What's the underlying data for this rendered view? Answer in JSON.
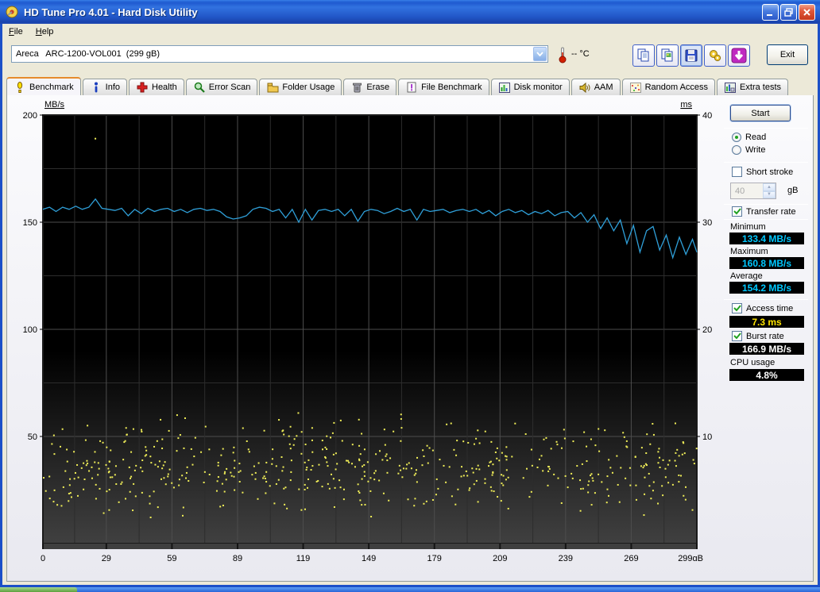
{
  "window": {
    "title": "HD Tune Pro 4.01 - Hard Disk Utility",
    "controls": [
      "minimize",
      "maximize",
      "close"
    ]
  },
  "menu": {
    "items": [
      {
        "label": "File"
      },
      {
        "label": "Help"
      }
    ]
  },
  "toolbar": {
    "drive_selector_value": "Areca   ARC-1200-VOL001  (299 gB)",
    "temperature": "-- °C",
    "buttons": [
      {
        "name": "copy-text"
      },
      {
        "name": "copy-image"
      },
      {
        "name": "save"
      },
      {
        "name": "options"
      },
      {
        "name": "download"
      }
    ],
    "exit_label": "Exit"
  },
  "tabs": [
    {
      "label": "Benchmark",
      "active": true
    },
    {
      "label": "Info"
    },
    {
      "label": "Health"
    },
    {
      "label": "Error Scan"
    },
    {
      "label": "Folder Usage"
    },
    {
      "label": "Erase"
    },
    {
      "label": "File Benchmark"
    },
    {
      "label": "Disk monitor"
    },
    {
      "label": "AAM"
    },
    {
      "label": "Random Access"
    },
    {
      "label": "Extra tests"
    }
  ],
  "panel": {
    "start_label": "Start",
    "read_label": "Read",
    "write_label": "Write",
    "short_stroke_label": "Short stroke",
    "stroke_value": "40",
    "stroke_unit": "gB",
    "transfer_rate_label": "Transfer rate",
    "minimum_label": "Minimum",
    "minimum_value": "133.4 MB/s",
    "maximum_label": "Maximum",
    "maximum_value": "160.8 MB/s",
    "average_label": "Average",
    "average_value": "154.2 MB/s",
    "access_time_label": "Access time",
    "access_time_value": "7.3 ms",
    "burst_rate_label": "Burst rate",
    "burst_rate_value": "166.9 MB/s",
    "cpu_usage_label": "CPU usage",
    "cpu_usage_value": "4.8%"
  },
  "chart_data": {
    "type": "line",
    "title": "HD Tune benchmark: transfer rate line (left axis, MB/s) + access time scatter (right axis, ms)",
    "x_axis": {
      "min": 0,
      "max": 299,
      "ticks": [
        0,
        29,
        59,
        89,
        119,
        149,
        179,
        209,
        239,
        269,
        299
      ],
      "unit": "gB"
    },
    "y_left": {
      "label": "MB/s",
      "min": 0,
      "max": 200,
      "ticks": [
        200,
        150,
        100,
        50
      ]
    },
    "y_right": {
      "label": "ms",
      "min": 0,
      "max": 40,
      "ticks": [
        40,
        30,
        20,
        10
      ]
    },
    "grid": {
      "major_color": "#4d4d4d",
      "minor_color": "#2d2d2d",
      "bg_top": "#000000",
      "bg_bottom": "#404040"
    },
    "series": [
      {
        "name": "transfer-rate",
        "axis": "left",
        "color": "#2f9fd8",
        "points": [
          [
            0,
            156
          ],
          [
            3,
            157
          ],
          [
            6,
            155
          ],
          [
            9,
            157
          ],
          [
            12,
            156
          ],
          [
            15,
            157.5
          ],
          [
            18,
            156
          ],
          [
            21,
            157
          ],
          [
            24,
            160.8
          ],
          [
            27,
            156.5
          ],
          [
            30,
            156
          ],
          [
            33,
            155.5
          ],
          [
            36,
            156.5
          ],
          [
            39,
            153
          ],
          [
            42,
            156
          ],
          [
            45,
            154
          ],
          [
            48,
            156.5
          ],
          [
            51,
            155
          ],
          [
            54,
            156
          ],
          [
            57,
            156.5
          ],
          [
            60,
            155
          ],
          [
            63,
            156
          ],
          [
            66,
            154.5
          ],
          [
            69,
            156
          ],
          [
            72,
            156.5
          ],
          [
            75,
            155.5
          ],
          [
            78,
            156
          ],
          [
            81,
            155
          ],
          [
            84,
            152.5
          ],
          [
            87,
            151.5
          ],
          [
            90,
            152
          ],
          [
            93,
            153
          ],
          [
            96,
            156
          ],
          [
            99,
            157
          ],
          [
            102,
            156.5
          ],
          [
            105,
            155
          ],
          [
            108,
            156
          ],
          [
            111,
            152
          ],
          [
            114,
            156
          ],
          [
            117,
            150
          ],
          [
            120,
            156
          ],
          [
            123,
            151
          ],
          [
            126,
            155.5
          ],
          [
            129,
            156
          ],
          [
            132,
            155
          ],
          [
            135,
            156
          ],
          [
            138,
            153
          ],
          [
            141,
            156
          ],
          [
            144,
            150.5
          ],
          [
            147,
            155
          ],
          [
            150,
            156
          ],
          [
            153,
            155.5
          ],
          [
            156,
            154
          ],
          [
            159,
            155
          ],
          [
            162,
            156.5
          ],
          [
            165,
            155
          ],
          [
            168,
            156
          ],
          [
            171,
            151
          ],
          [
            174,
            156
          ],
          [
            177,
            155
          ],
          [
            180,
            155.5
          ],
          [
            183,
            156
          ],
          [
            186,
            154.5
          ],
          [
            189,
            155.5
          ],
          [
            192,
            156
          ],
          [
            195,
            155
          ],
          [
            198,
            156
          ],
          [
            201,
            154
          ],
          [
            204,
            155.5
          ],
          [
            207,
            153
          ],
          [
            210,
            155
          ],
          [
            213,
            156
          ],
          [
            216,
            154.5
          ],
          [
            219,
            155.5
          ],
          [
            222,
            153.5
          ],
          [
            225,
            155
          ],
          [
            228,
            154
          ],
          [
            231,
            155.5
          ],
          [
            234,
            153
          ],
          [
            237,
            154.5
          ],
          [
            240,
            155
          ],
          [
            243,
            152
          ],
          [
            246,
            154.5
          ],
          [
            249,
            150
          ],
          [
            252,
            153.5
          ],
          [
            255,
            147
          ],
          [
            258,
            152
          ],
          [
            261,
            146
          ],
          [
            264,
            151
          ],
          [
            267,
            140
          ],
          [
            270,
            148.5
          ],
          [
            273,
            136
          ],
          [
            276,
            146
          ],
          [
            279,
            148
          ],
          [
            282,
            137
          ],
          [
            285,
            144
          ],
          [
            288,
            133.4
          ],
          [
            291,
            143
          ],
          [
            294,
            135
          ],
          [
            297,
            142
          ],
          [
            299,
            136
          ]
        ]
      },
      {
        "name": "access-time",
        "axis": "right",
        "type": "scatter",
        "color": "#f0ee58",
        "generator": {
          "seed": 1337,
          "count": 560,
          "ms_min": 2.2,
          "ms_max": 12.4
        },
        "outliers": [
          [
            24,
            37.8
          ]
        ]
      }
    ]
  }
}
